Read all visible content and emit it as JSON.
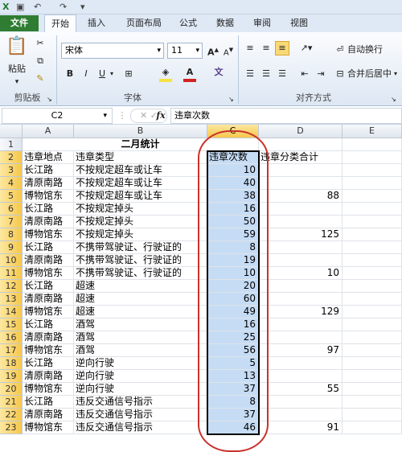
{
  "ribbon": {
    "tabs": [
      "文件",
      "开始",
      "插入",
      "页面布局",
      "公式",
      "数据",
      "审阅",
      "视图"
    ],
    "clipboard": {
      "paste": "粘贴",
      "group": "剪贴板"
    },
    "font": {
      "name": "宋体",
      "size": "11",
      "group": "字体",
      "underline": "U",
      "bold": "B",
      "italic": "I"
    },
    "align": {
      "wrap": "自动换行",
      "merge": "合并后居中",
      "group": "对齐方式"
    },
    "colors": {
      "fill": "#f5e342",
      "font": "#d22222",
      "file_tab": "#2f7d32"
    }
  },
  "formula_bar": {
    "name_box": "C2",
    "fx": "fx",
    "content": "违章次数"
  },
  "columns": [
    "A",
    "B",
    "C",
    "D",
    "E"
  ],
  "title": "二月统计",
  "headers": {
    "a": "违章地点",
    "b": "违章类型",
    "c": "违章次数",
    "d": "违章分类合计"
  },
  "rows": [
    {
      "n": "1"
    },
    {
      "n": "2"
    },
    {
      "n": "3",
      "a": "长江路",
      "b": "不按规定超车或让车",
      "c": "10",
      "d": ""
    },
    {
      "n": "4",
      "a": "清原南路",
      "b": "不按规定超车或让车",
      "c": "40",
      "d": ""
    },
    {
      "n": "5",
      "a": "博物馆东",
      "b": "不按规定超车或让车",
      "c": "38",
      "d": "88"
    },
    {
      "n": "6",
      "a": "长江路",
      "b": "不按规定掉头",
      "c": "16",
      "d": ""
    },
    {
      "n": "7",
      "a": "清原南路",
      "b": "不按规定掉头",
      "c": "50",
      "d": ""
    },
    {
      "n": "8",
      "a": "博物馆东",
      "b": "不按规定掉头",
      "c": "59",
      "d": "125"
    },
    {
      "n": "9",
      "a": "长江路",
      "b": "不携带驾驶证、行驶证的",
      "c": "8",
      "d": ""
    },
    {
      "n": "10",
      "a": "清原南路",
      "b": "不携带驾驶证、行驶证的",
      "c": "19",
      "d": ""
    },
    {
      "n": "11",
      "a": "博物馆东",
      "b": "不携带驾驶证、行驶证的",
      "c": "10",
      "d": "10"
    },
    {
      "n": "12",
      "a": "长江路",
      "b": "超速",
      "c": "20",
      "d": ""
    },
    {
      "n": "13",
      "a": "清原南路",
      "b": "超速",
      "c": "60",
      "d": ""
    },
    {
      "n": "14",
      "a": "博物馆东",
      "b": "超速",
      "c": "49",
      "d": "129"
    },
    {
      "n": "15",
      "a": "长江路",
      "b": "酒驾",
      "c": "16",
      "d": ""
    },
    {
      "n": "16",
      "a": "清原南路",
      "b": "酒驾",
      "c": "25",
      "d": ""
    },
    {
      "n": "17",
      "a": "博物馆东",
      "b": "酒驾",
      "c": "56",
      "d": "97"
    },
    {
      "n": "18",
      "a": "长江路",
      "b": "逆向行驶",
      "c": "5",
      "d": ""
    },
    {
      "n": "19",
      "a": "清原南路",
      "b": "逆向行驶",
      "c": "13",
      "d": ""
    },
    {
      "n": "20",
      "a": "博物馆东",
      "b": "逆向行驶",
      "c": "37",
      "d": "55"
    },
    {
      "n": "21",
      "a": "长江路",
      "b": "违反交通信号指示",
      "c": "8",
      "d": ""
    },
    {
      "n": "22",
      "a": "清原南路",
      "b": "违反交通信号指示",
      "c": "37",
      "d": ""
    },
    {
      "n": "23",
      "a": "博物馆东",
      "b": "违反交通信号指示",
      "c": "46",
      "d": "91"
    }
  ]
}
